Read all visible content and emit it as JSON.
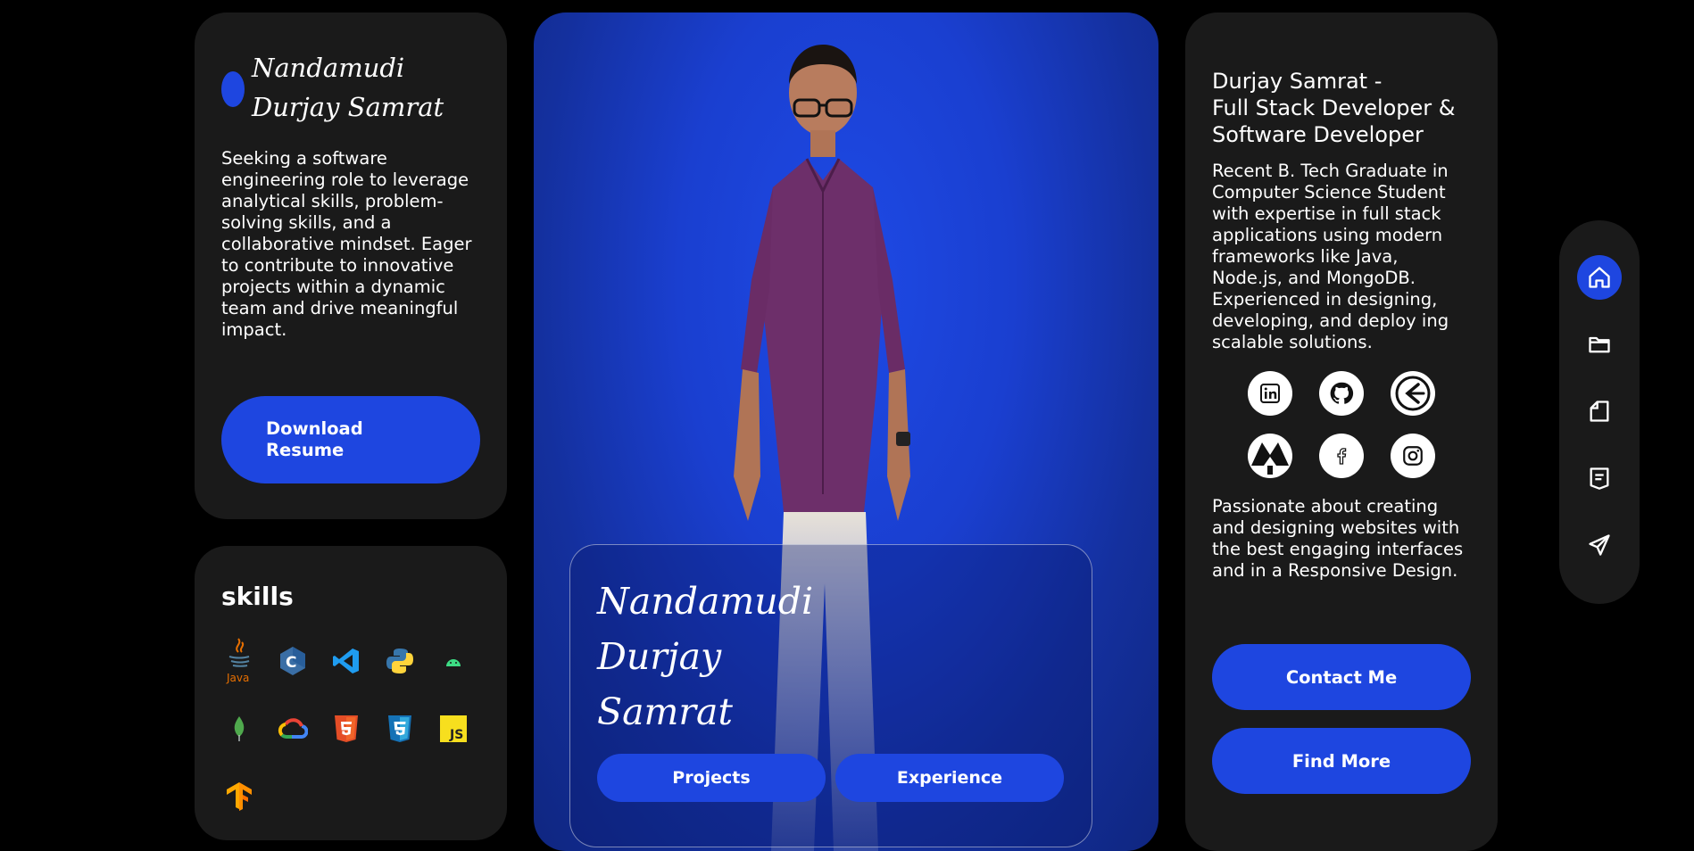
{
  "brand": {
    "name": "Nandamudi\nDurjay Samrat"
  },
  "intro": {
    "text": "Seeking a software engineering role to leverage analytical skills, problem-solving skills, and a collaborative mindset. Eager to contribute to innovative projects within a dynamic team and drive meaningful impact.",
    "download_label": "Download\nResume"
  },
  "skills": {
    "title": "skills",
    "items": [
      "java-icon",
      "c-icon",
      "vscode-icon",
      "python-icon",
      "android-icon",
      "mongodb-icon",
      "google-cloud-icon",
      "html5-icon",
      "css3-icon",
      "javascript-icon",
      "tensorflow-icon"
    ]
  },
  "hero": {
    "name": "Nandamudi\nDurjay\nSamrat",
    "projects_label": "Projects",
    "experience_label": "Experience"
  },
  "about": {
    "title": "Durjay Samrat -\nFull Stack Developer &\nSoftware Developer",
    "text": "Recent B. Tech Graduate in Computer Science Student with expertise in full stack applications using modern frameworks like Java, Node.js, and MongoDB. Experienced in designing, developing, and deploy ing scalable solutions.",
    "socials": [
      "linkedin-icon",
      "github-icon",
      "leetcode-icon",
      "codechef-icon",
      "facebook-icon",
      "instagram-icon"
    ],
    "passion": "Passionate about creating and designing websites with the best engaging interfaces and in a Responsive Design.",
    "contact_label": "Contact Me",
    "findmore_label": "Find More"
  },
  "nav": [
    "home-icon",
    "folder-icon",
    "file-icon",
    "resume-icon",
    "send-icon"
  ],
  "colors": {
    "accent": "#1e46e0",
    "card": "#1a1a1a",
    "background": "#000000"
  }
}
